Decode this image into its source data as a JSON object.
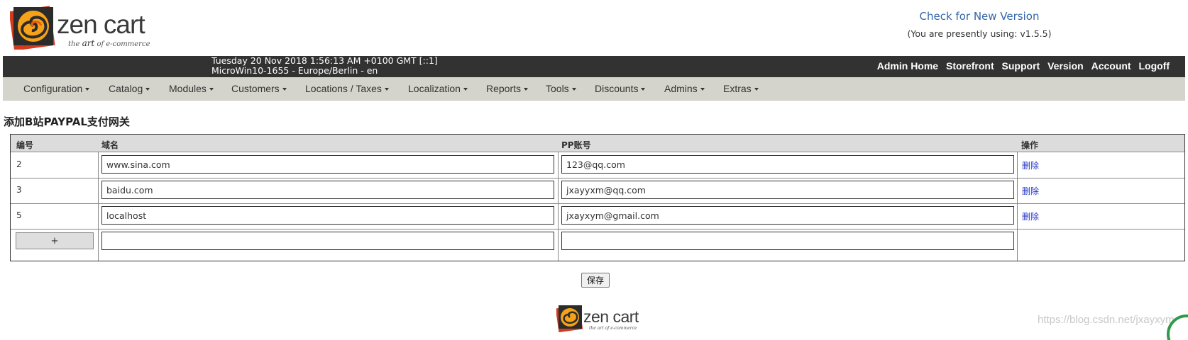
{
  "brand": {
    "name": "zen cart",
    "tagline_pre": "the",
    "tagline_art": "art",
    "tagline_post": "of e-commerce"
  },
  "version": {
    "check_link": "Check for New Version",
    "using_text": "(You are presently using: v1.5.5)"
  },
  "topbar": {
    "datetime": "Tuesday 20 Nov 2018 1:56:13 AM +0100 GMT [::1]",
    "host": "MicroWin10-1655 - Europe/Berlin - en",
    "links": [
      "Admin Home",
      "Storefront",
      "Support",
      "Version",
      "Account",
      "Logoff"
    ]
  },
  "menu": [
    "Configuration",
    "Catalog",
    "Modules",
    "Customers",
    "Locations / Taxes",
    "Localization",
    "Reports",
    "Tools",
    "Discounts",
    "Admins",
    "Extras"
  ],
  "page": {
    "title_pre": "添加B站",
    "title_mid": "PAYPAL",
    "title_post": "支付网关"
  },
  "table": {
    "headers": {
      "id": "编号",
      "domain": "域名",
      "pp": "PP账号",
      "ops": "操作"
    },
    "rows": [
      {
        "id": "2",
        "domain": "www.sina.com",
        "pp": "123@qq.com",
        "action": "删除"
      },
      {
        "id": "3",
        "domain": "baidu.com",
        "pp": "jxayyxm@qq.com",
        "action": "删除"
      },
      {
        "id": "5",
        "domain": "localhost",
        "pp": "jxayxym@gmail.com",
        "action": "删除"
      }
    ],
    "add_label": "+",
    "new_row": {
      "domain": "",
      "pp": ""
    }
  },
  "save_label": "保存",
  "watermark": "https://blog.csdn.net/jxayxym",
  "colors": {
    "topbar": "#323232",
    "menubar": "#d4d4cc",
    "link": "#3366aa",
    "delete_link": "#2233cc"
  }
}
